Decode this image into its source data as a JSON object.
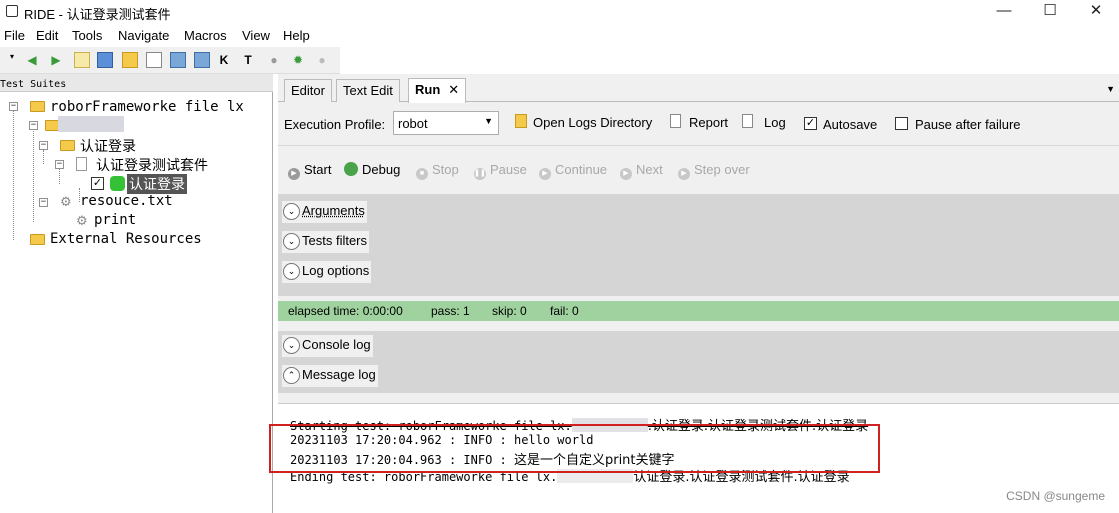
{
  "window": {
    "title": "RIDE - 认证登录测试套件",
    "minimize": "—",
    "maximize": "☐",
    "close": "✕"
  },
  "menu": [
    "File",
    "Edit",
    "Tools",
    "Navigate",
    "Macros",
    "View",
    "Help"
  ],
  "tree": {
    "header": "Test Suites",
    "root": "roborFrameworke file lx",
    "suite": "认证登录",
    "suite_file": "认证登录测试套件",
    "test_case": "认证登录",
    "resource": "resouce.txt",
    "keyword": "print",
    "external": "External Resources"
  },
  "tabs": {
    "editor": "Editor",
    "text_edit": "Text Edit",
    "run": "Run",
    "close": "✕"
  },
  "exec": {
    "profile_label": "Execution Profile:",
    "profile_value": "robot",
    "open_logs": "Open Logs Directory",
    "report": "Report",
    "log": "Log",
    "autosave": "Autosave",
    "autosave_checked": true,
    "pause_after_failure": "Pause after failure",
    "pause_checked": false
  },
  "run_buttons": {
    "start": "Start",
    "debug": "Debug",
    "stop": "Stop",
    "pause": "Pause",
    "continue": "Continue",
    "next": "Next",
    "step_over": "Step over"
  },
  "sections": {
    "arguments": "Arguments",
    "tests_filters": "Tests filters",
    "log_options": "Log options",
    "console_log": "Console log",
    "message_log": "Message log"
  },
  "stats": {
    "elapsed": "elapsed time: 0:00:00",
    "pass": "pass: 1",
    "skip": "skip: 0",
    "fail": "fail: 0",
    "bar_color": "#9fd29f"
  },
  "log": {
    "line1_prefix": "Starting test: roborFrameworke file lx.",
    "line1_suffix": ".认证登录.认证登录测试套件.认证登录",
    "line2": "20231103 17:20:04.962 :  INFO : hello world",
    "line3_prefix": "20231103 17:20:04.963 :  INFO : ",
    "line3_cjk": "这是一个自定义print关键字",
    "line4_prefix": "Ending test: roborFrameworke file lx.",
    "line4_suffix": "认证登录.认证登录测试套件.认证登录"
  },
  "watermark": "CSDN @sungeme",
  "colors": {
    "highlight_box": "#d02020",
    "pass_bar": "#9fd29f"
  }
}
